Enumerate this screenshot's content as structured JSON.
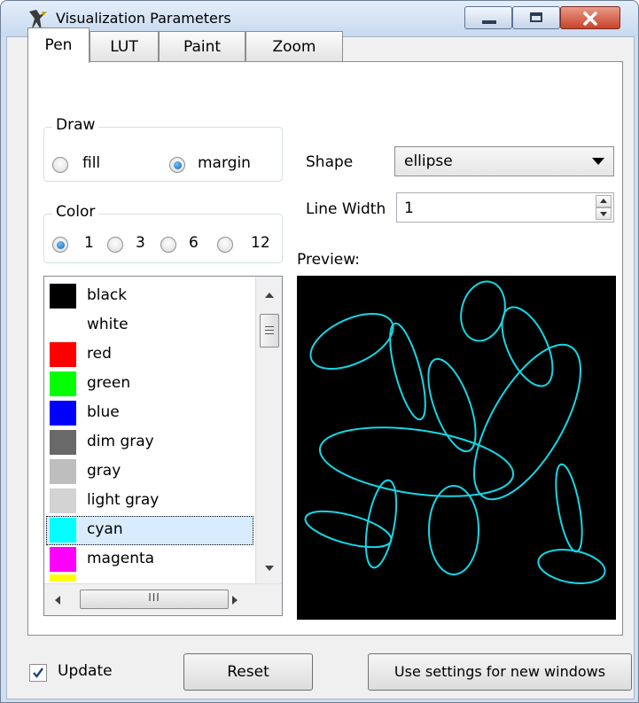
{
  "window": {
    "title": "Visualization Parameters"
  },
  "tabs": [
    {
      "label": "Pen"
    },
    {
      "label": "LUT"
    },
    {
      "label": "Paint"
    },
    {
      "label": "Zoom"
    }
  ],
  "draw": {
    "label": "Draw",
    "options": [
      {
        "label": "fill",
        "selected": false
      },
      {
        "label": "margin",
        "selected": true
      }
    ]
  },
  "color_count": {
    "label": "Color",
    "options": [
      {
        "label": "1",
        "selected": true
      },
      {
        "label": "3",
        "selected": false
      },
      {
        "label": "6",
        "selected": false
      },
      {
        "label": "12",
        "selected": false
      }
    ]
  },
  "shape": {
    "label": "Shape",
    "value": "ellipse"
  },
  "line_width": {
    "label": "Line Width",
    "value": "1"
  },
  "preview": {
    "label": "Preview:",
    "stroke_color": "#14d7e6"
  },
  "colors": [
    {
      "label": "black",
      "hex": "#000000"
    },
    {
      "label": "white",
      "hex": "#ffffff"
    },
    {
      "label": "red",
      "hex": "#ff0000"
    },
    {
      "label": "green",
      "hex": "#00ff00"
    },
    {
      "label": "blue",
      "hex": "#0000ff"
    },
    {
      "label": "dim gray",
      "hex": "#696969"
    },
    {
      "label": "gray",
      "hex": "#bebebe"
    },
    {
      "label": "light gray",
      "hex": "#d3d3d3"
    },
    {
      "label": "cyan",
      "hex": "#00ffff",
      "selected": true
    },
    {
      "label": "magenta",
      "hex": "#ff00ff"
    }
  ],
  "footer": {
    "update_label": "Update",
    "update_checked": true,
    "reset_label": "Reset",
    "use_settings_label": "Use settings for new windows"
  },
  "icons": {
    "scroll_mid": "III"
  }
}
